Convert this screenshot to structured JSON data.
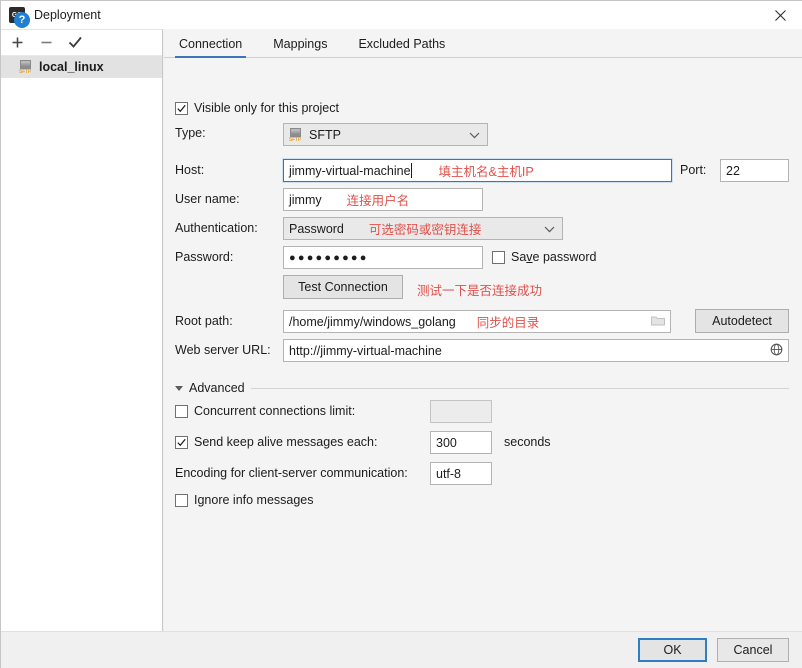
{
  "window": {
    "title": "Deployment",
    "logo_text": "GO",
    "close_icon": "close-icon"
  },
  "sidebar": {
    "toolbar": [
      {
        "name": "add-button",
        "glyph": "+"
      },
      {
        "name": "remove-button",
        "glyph": "−"
      },
      {
        "name": "set-default-button",
        "glyph": "✓"
      }
    ],
    "items": [
      {
        "label": "local_linux",
        "badge": "SFTP"
      }
    ]
  },
  "tabs": [
    {
      "label": "Connection",
      "active": true
    },
    {
      "label": "Mappings",
      "active": false
    },
    {
      "label": "Excluded Paths",
      "active": false
    }
  ],
  "form": {
    "visible_only_label": "Visible only for this project",
    "visible_only_checked": true,
    "type_label": "Type:",
    "type_value": "SFTP",
    "type_badge": "SFTP",
    "host_label": "Host:",
    "host_value": "jimmy-virtual-machine",
    "host_note": "填主机名&主机IP",
    "port_label": "Port:",
    "port_value": "22",
    "username_label": "User name:",
    "username_value": "jimmy",
    "username_note": "连接用户名",
    "auth_label": "Authentication:",
    "auth_value": "Password",
    "auth_note": "可选密码或密钥连接",
    "password_label": "Password:",
    "password_value": "●●●●●●●●●",
    "save_password_label": "Save password",
    "save_password_checked": false,
    "test_connection_label": "Test Connection",
    "test_connection_note": "测试一下是否连接成功",
    "root_path_label": "Root path:",
    "root_path_value": "/home/jimmy/windows_golang",
    "root_path_note": "同步的目录",
    "autodetect_label": "Autodetect",
    "web_url_label": "Web server URL:",
    "web_url_value": "http://jimmy-virtual-machine"
  },
  "advanced": {
    "title": "Advanced",
    "expanded": true,
    "concurrent_label": "Concurrent connections limit:",
    "concurrent_checked": false,
    "concurrent_value": "",
    "keepalive_label": "Send keep alive messages each:",
    "keepalive_checked": true,
    "keepalive_value": "300",
    "keepalive_units": "seconds",
    "encoding_label": "Encoding for client-server communication:",
    "encoding_value": "utf-8",
    "ignore_info_label": "Ignore info messages",
    "ignore_info_checked": false
  },
  "footer": {
    "help_icon": "?",
    "ok_label": "OK",
    "cancel_label": "Cancel"
  },
  "colors": {
    "accent": "#3d74b8",
    "note": "#e2504a",
    "focus_border": "#2e7ec4"
  }
}
